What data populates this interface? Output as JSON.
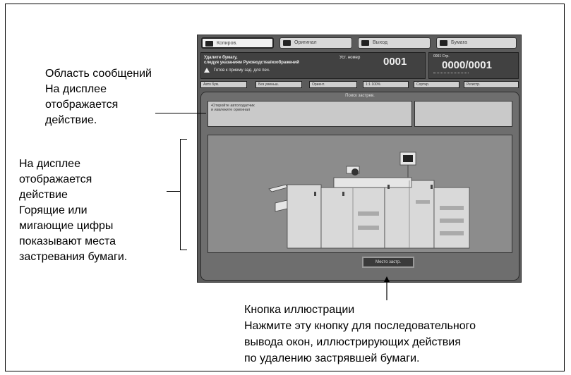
{
  "screen": {
    "tabs": [
      {
        "label": "Копиров.",
        "active": true
      },
      {
        "label": "Оригинал",
        "active": false
      },
      {
        "label": "Выход",
        "active": false
      },
      {
        "label": "Бумага",
        "active": false
      }
    ],
    "message": {
      "line1": "Удалите бумагу,",
      "line2": "следуя указаниям Руководства/изображений",
      "status": "Готов к приему зад. для печ.",
      "set_number_label": "Уст. номер",
      "set_number": "0001"
    },
    "counter": {
      "small": "0001  Стр.",
      "value": "0000/0001"
    },
    "function_buttons": [
      "Авто бум.",
      "Без уменьш.",
      "Ориент.",
      "1:1  100%",
      "Сортир.",
      "Регистр."
    ],
    "panel_title": "Поиск застрев.",
    "message_area": {
      "line1": "•Откройте автоподатчик",
      "line2": "и извлеките оригинал"
    },
    "jam_button_label": "Место застр."
  },
  "annotations": {
    "message_area": [
      "Область сообщений",
      "На дисплее",
      "отображается",
      "действие."
    ],
    "display_action": [
      "На дисплее",
      "отображается",
      "действие",
      "Горящие или",
      "мигающие цифры",
      "показывают места",
      "застревания бумаги."
    ],
    "illustration_button": [
      "Кнопка иллюстрации",
      "Нажмите эту кнопку для последовательного",
      "вывода окон, иллюстрирующих действия",
      "по удалению застрявшей бумаги."
    ]
  },
  "colors": {
    "screen_bg": "#5b5b5b",
    "panel_bg": "#6e6e6e",
    "illustration_bg": "#8c8c8c",
    "machine": "#d9d9d9"
  }
}
